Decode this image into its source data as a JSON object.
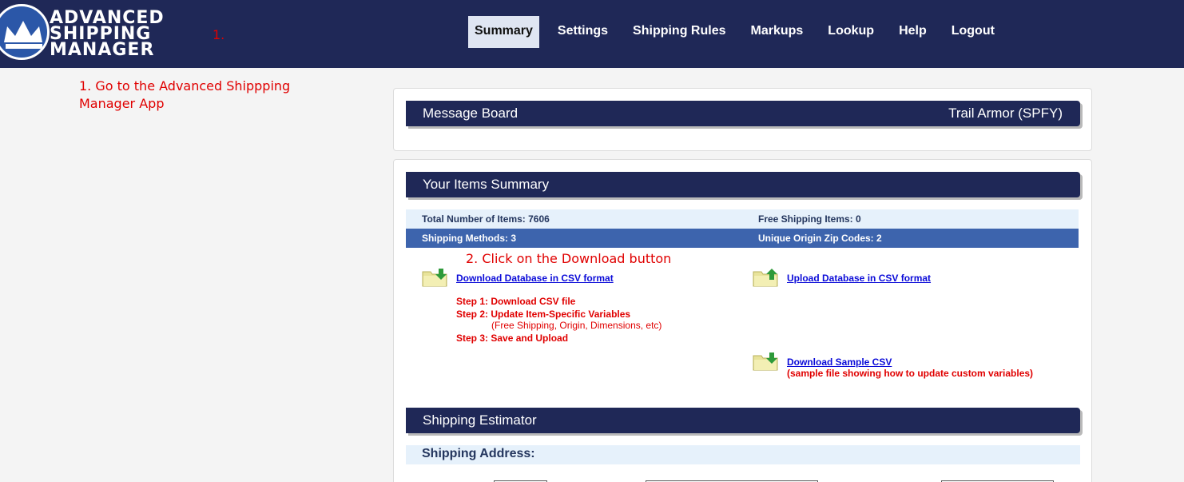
{
  "header": {
    "logo_lines": [
      "ADVANCED",
      "SHIPPING",
      "MANAGER"
    ],
    "annotation": "1.",
    "nav": [
      {
        "label": "Summary",
        "active": true
      },
      {
        "label": "Settings",
        "active": false
      },
      {
        "label": "Shipping Rules",
        "active": false
      },
      {
        "label": "Markups",
        "active": false
      },
      {
        "label": "Lookup",
        "active": false
      },
      {
        "label": "Help",
        "active": false
      },
      {
        "label": "Logout",
        "active": false
      }
    ]
  },
  "annotations": {
    "step1": "1. Go to the Advanced Shippping Manager App",
    "step2": "2. Click on the Download button"
  },
  "message_board": {
    "title": "Message Board",
    "store": "Trail Armor (SPFY)"
  },
  "summary": {
    "title": "Your Items Summary",
    "total_items": "Total Number of Items: 7606",
    "free_shipping": "Free Shipping Items: 0",
    "shipping_methods": "Shipping Methods: 3",
    "origin_zips": "Unique Origin Zip Codes: 2",
    "download_link": "Download Database in CSV format",
    "upload_link": "Upload Database in CSV format",
    "steps": {
      "s1": "Step 1:  Download CSV file",
      "s2": "Step 2:  Update Item-Specific Variables",
      "s2_note": "(Free Shipping, Origin, Dimensions, etc)",
      "s3": "Step 3:  Save and Upload"
    },
    "sample_link": "Download Sample CSV",
    "sample_note": "(sample file showing how to update custom variables)"
  },
  "estimator": {
    "title": "Shipping Estimator",
    "address_label": "Shipping Address:"
  },
  "colors": {
    "navy": "#1f2857",
    "accent_blue": "#3d64ad",
    "light_blue": "#e6f1fb",
    "annotation_red": "#e00000"
  }
}
